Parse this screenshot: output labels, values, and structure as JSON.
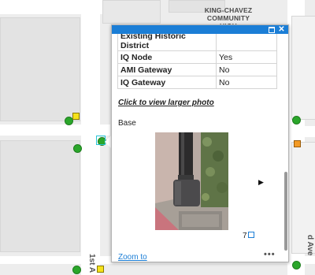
{
  "map": {
    "labels": {
      "community": [
        "KING-CHAVEZ",
        "COMMUNITY",
        "HIGH"
      ],
      "street_left": "1st A",
      "street_right": "d Ave"
    }
  },
  "popup": {
    "table_rows": [
      {
        "key": "Existing Historic District",
        "value": ""
      },
      {
        "key": "IQ Node",
        "value": "Yes"
      },
      {
        "key": "AMI Gateway",
        "value": "No"
      },
      {
        "key": "IQ Gateway",
        "value": "No"
      }
    ],
    "photo_link": "Click to view larger photo",
    "media_title": "Base",
    "media_count": "7",
    "zoom_label": "Zoom to",
    "more_label": "•••",
    "close_label": "✕"
  },
  "colors": {
    "header": "#1b7ed6",
    "green_marker": "#2aa62a",
    "yellow_marker": "#f5e21b",
    "orange_marker": "#f39a25",
    "selection": "#27c4d6"
  }
}
